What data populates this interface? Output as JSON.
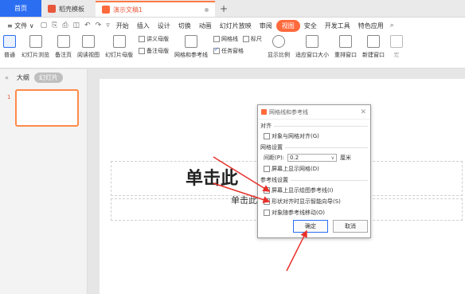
{
  "tabs": [
    {
      "label": "首页",
      "kind": "home"
    },
    {
      "label": "稻壳模板",
      "kind": "doc",
      "logo_color": "#e8573a"
    },
    {
      "label": "演示文稿1",
      "kind": "active",
      "logo_color": "#ff6a3d"
    }
  ],
  "new_tab_label": "+",
  "menu": {
    "file_label": "≡ 文件 ∨",
    "items": [
      "开始",
      "插入",
      "设计",
      "切换",
      "动画",
      "幻灯片放映",
      "审阅",
      "视图",
      "安全",
      "开发工具",
      "特色应用"
    ],
    "active_item": "视图",
    "search_icon": "search-icon"
  },
  "ribbon": {
    "normal": "普通",
    "slide_browse": "幻灯片浏览",
    "notes_page": "备注页",
    "reading_view": "阅读视图",
    "slide_master": "幻灯片母版",
    "handout_master": "讲义母版",
    "notes_master": "备注母版",
    "grid_guides": "网格和参考线",
    "gridlines": "网格线",
    "ruler": "标尺",
    "task_pane": "任务窗格",
    "zoom": "显示比例",
    "fit_window": "适应窗口大小",
    "arrange_window": "重排窗口",
    "new_window": "新建窗口",
    "macro": "宏"
  },
  "left_panel": {
    "outline_tab": "大纲",
    "slides_tab": "幻灯片",
    "slide_number": "1"
  },
  "slide": {
    "title_placeholder": "单击此",
    "subtitle_placeholder": "单击此"
  },
  "dialog": {
    "title": "网格线和参考线",
    "sections": {
      "snap": "对齐",
      "grid": "网格设置",
      "guides": "参考线设置"
    },
    "options": {
      "snap_to_grid": {
        "label": "对象与网格对齐(G)",
        "checked": false
      },
      "show_grid": {
        "label": "屏幕上显示网格(D)",
        "checked": false
      },
      "show_guides": {
        "label": "屏幕上显示绘图参考线(I)",
        "checked": true
      },
      "smart_guides": {
        "label": "形状对齐时显示智能向导(S)",
        "checked": true
      },
      "move_with_guides": {
        "label": "对象随参考线移动(O)",
        "checked": false
      }
    },
    "spacing_label": "间距(P):",
    "spacing_value": "0.2",
    "spacing_unit": "厘米",
    "ok_label": "确定",
    "cancel_label": "取消"
  },
  "colors": {
    "accent_orange": "#ff6a3d",
    "home_blue": "#2b6ef2",
    "arrow_red": "#e8302a"
  }
}
